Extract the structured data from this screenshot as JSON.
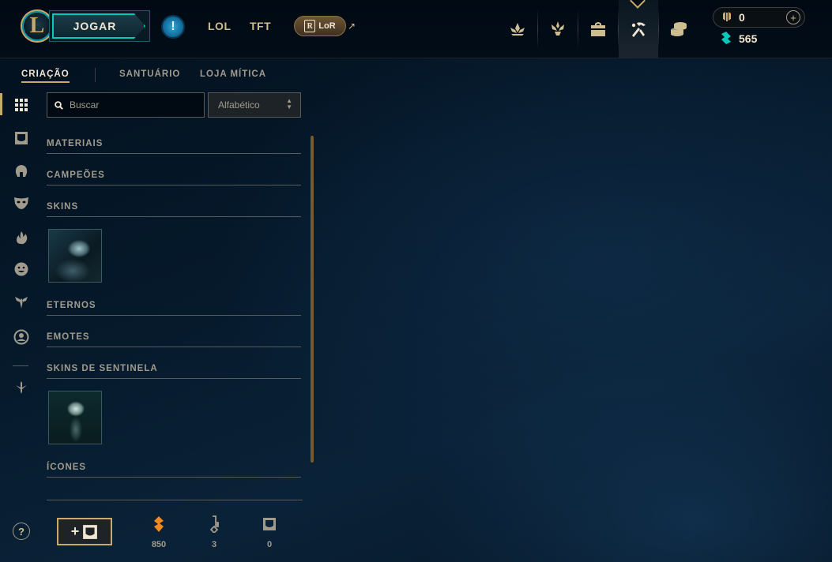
{
  "topbar": {
    "play_label": "JOGAR",
    "alert_symbol": "!",
    "tabs": [
      "LOL",
      "TFT"
    ],
    "lor_label": "LoR",
    "lor_badge": "R",
    "external_arrow": "↗",
    "nav_icons": [
      "lotus-icon",
      "trophy-icon",
      "backpack-icon",
      "crafting-icon",
      "coins-icon"
    ],
    "active_nav": "crafting-icon"
  },
  "currency": {
    "rp": "0",
    "be": "565",
    "plus": "+"
  },
  "subnav": {
    "tabs": [
      "CRIAÇÃO",
      "SANTUÁRIO",
      "LOJA MÍTICA"
    ],
    "active": "CRIAÇÃO"
  },
  "rail": {
    "icons": [
      "grid-icon",
      "chest-icon",
      "helmet-icon",
      "mask-icon",
      "flame-icon",
      "emote-icon",
      "ward-icon",
      "profile-icon",
      "anchor-icon"
    ],
    "help": "?"
  },
  "search": {
    "placeholder": "Buscar",
    "value": ""
  },
  "sort": {
    "selected": "Alfabético"
  },
  "categories": [
    "MATERIAIS",
    "CAMPEÕES",
    "SKINS",
    "ETERNOS",
    "EMOTES",
    "SKINS DE SENTINELA",
    "ÍCONES"
  ],
  "footer": {
    "craft_plus": "+",
    "resources": [
      {
        "icon": "orange-essence-icon",
        "value": "850"
      },
      {
        "icon": "key-icon",
        "value": "3"
      },
      {
        "icon": "chest-icon",
        "value": "0"
      }
    ]
  },
  "colors": {
    "gold": "#c8aa6e",
    "teal": "#0ac8b9",
    "text": "#a09b8c",
    "bright": "#f0e6d2",
    "orange": "#f0891f"
  }
}
